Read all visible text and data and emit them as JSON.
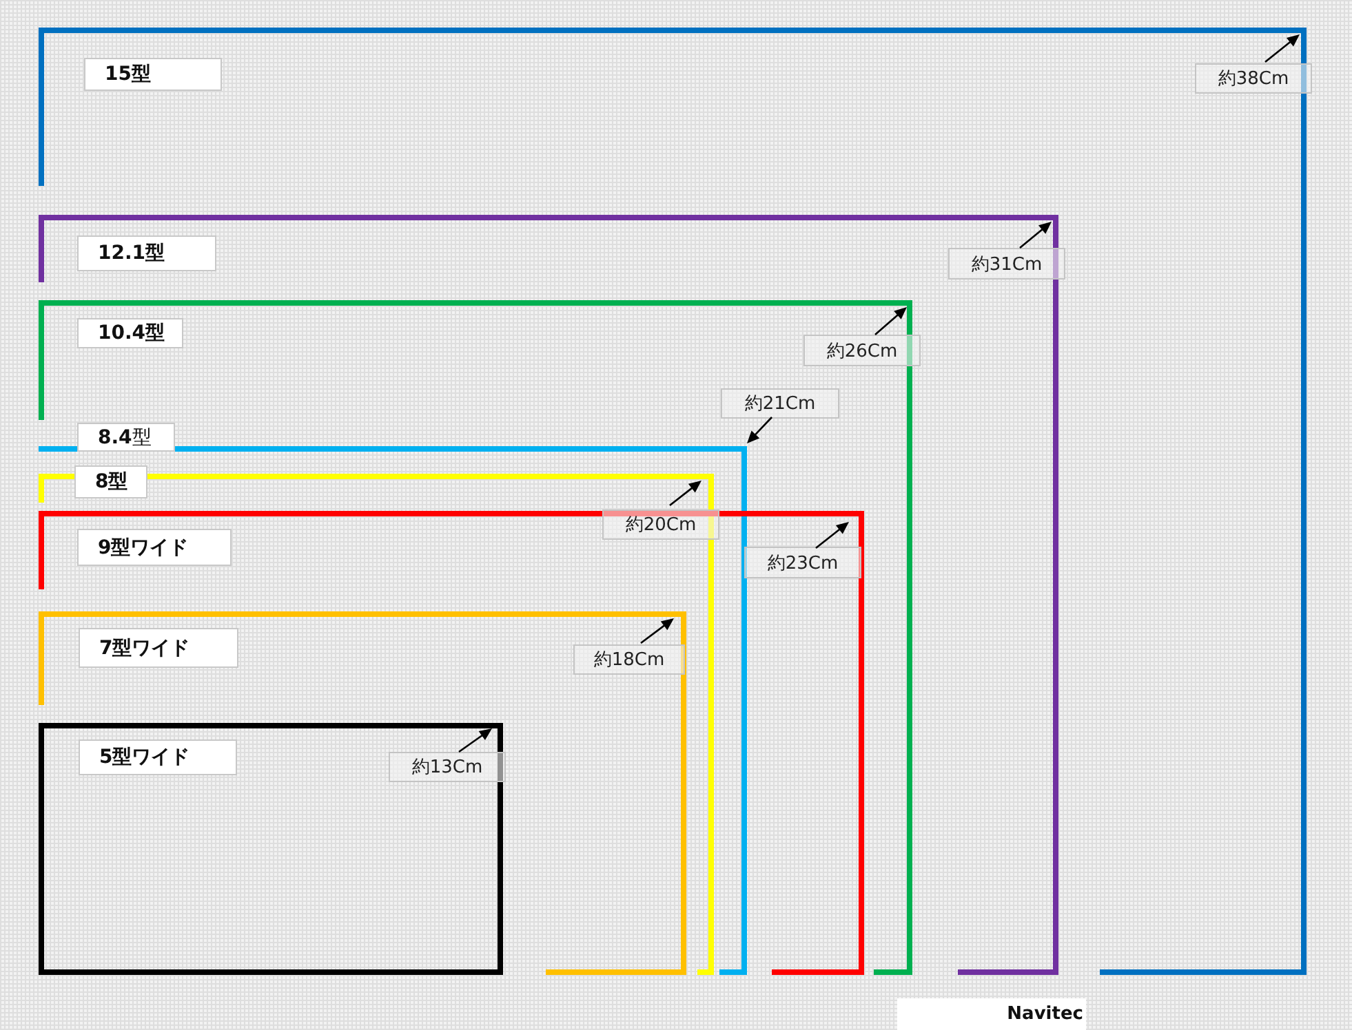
{
  "sizes": [
    {
      "label": "15型",
      "dimension": "約38Cm",
      "color": "#0070c0"
    },
    {
      "label": "12.1型",
      "dimension": "約31Cm",
      "color": "#7030a0"
    },
    {
      "label": "10.4型",
      "dimension": "約26Cm",
      "color": "#00b050"
    },
    {
      "label": "**8.4**型",
      "dimension": "約21Cm",
      "color": "#00b0f0"
    },
    {
      "label": "8型",
      "dimension": "約20Cm",
      "color": "#ffff00"
    },
    {
      "label": "9型ワイド",
      "dimension": "約23Cm",
      "color": "#ff0000"
    },
    {
      "label": "7型ワイド",
      "dimension": "約18Cm",
      "color": "#ffc000"
    },
    {
      "label": "5型ワイド",
      "dimension": "約13Cm",
      "color": "#000000"
    }
  ],
  "footer": {
    "brand": "Navitec"
  }
}
